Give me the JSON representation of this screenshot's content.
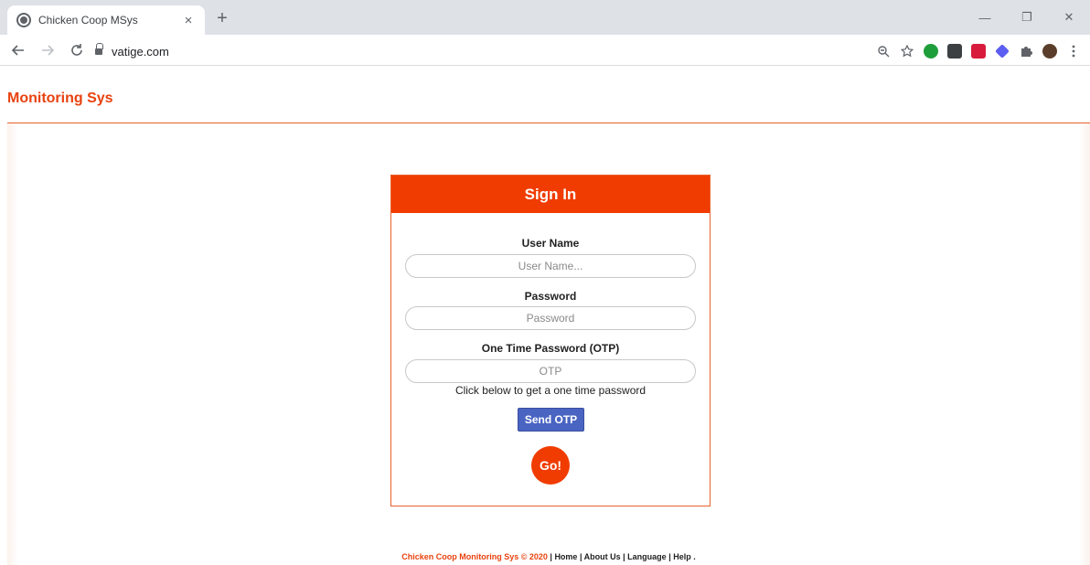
{
  "browser": {
    "tab_title": "Chicken Coop MSys",
    "tab_close": "×",
    "new_tab": "+",
    "url": "vatige.com",
    "win_minimize": "—",
    "win_restore": "❐",
    "win_close": "✕"
  },
  "site": {
    "brand": "Monitoring Sys"
  },
  "signin": {
    "title": "Sign In",
    "username_label": "User Name",
    "username_placeholder": "User Name...",
    "password_label": "Password",
    "password_placeholder": "Password",
    "otp_label": "One Time Password (OTP)",
    "otp_placeholder": "OTP",
    "otp_hint": "Click below to get a one time password",
    "send_otp": "Send OTP",
    "go": "Go!"
  },
  "footer": {
    "brand": "Chicken Coop Monitoring Sys © 2020",
    "sep": " | ",
    "home": "Home",
    "about": "About Us",
    "language": "Language",
    "help": "Help",
    "end": " ."
  },
  "colors": {
    "accent": "#f03c00",
    "brand_text": "#e8420f",
    "send_button": "#4a64c2"
  }
}
